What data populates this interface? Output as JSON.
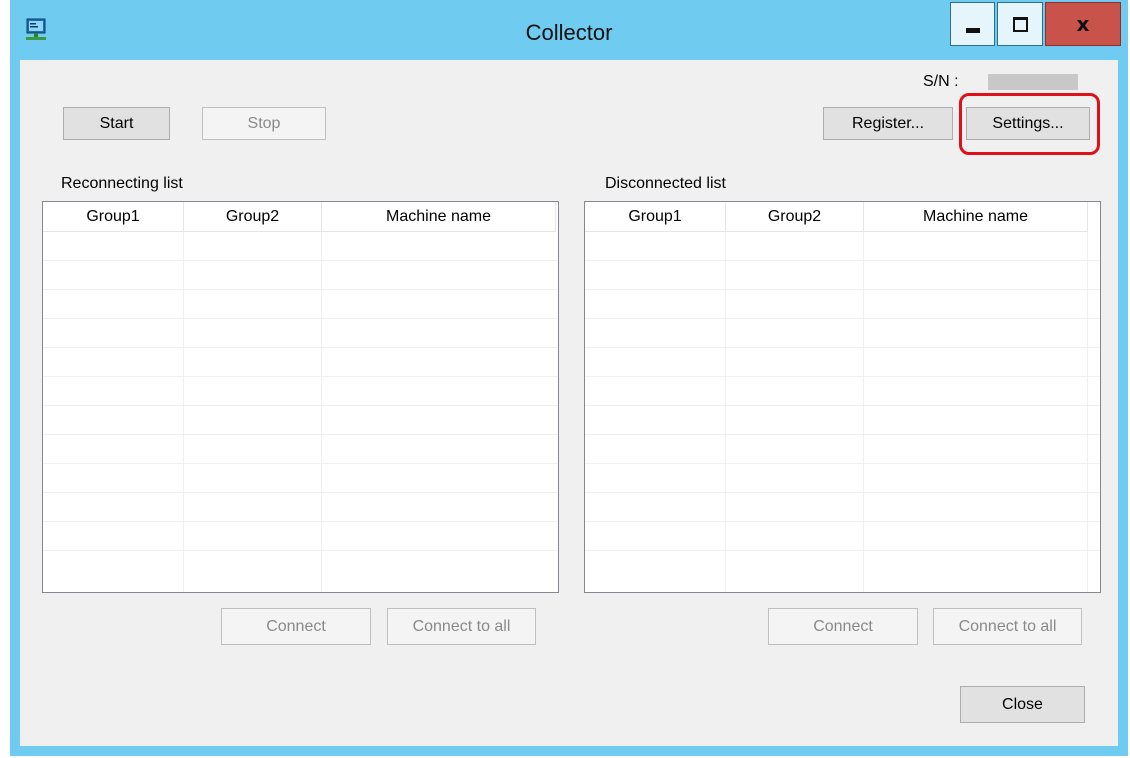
{
  "window": {
    "title": "Collector"
  },
  "titlebar": {
    "minimize_icon": "minimize-icon",
    "maximize_icon": "maximize-icon",
    "close_glyph": "x"
  },
  "serial": {
    "label": "S/N :"
  },
  "toolbar": {
    "start_label": "Start",
    "stop_label": "Stop",
    "register_label": "Register...",
    "settings_label": "Settings..."
  },
  "reconnecting": {
    "title": "Reconnecting list",
    "columns": [
      "Group1",
      "Group2",
      "Machine name"
    ],
    "connect_label": "Connect",
    "connect_all_label": "Connect to all"
  },
  "disconnected": {
    "title": "Disconnected list",
    "columns": [
      "Group1",
      "Group2",
      "Machine name"
    ],
    "connect_label": "Connect",
    "connect_all_label": "Connect to all"
  },
  "footer": {
    "close_label": "Close"
  },
  "colors": {
    "titlebar": "#6fcbf0",
    "close_button": "#c9524a",
    "highlight": "#e0101a"
  }
}
